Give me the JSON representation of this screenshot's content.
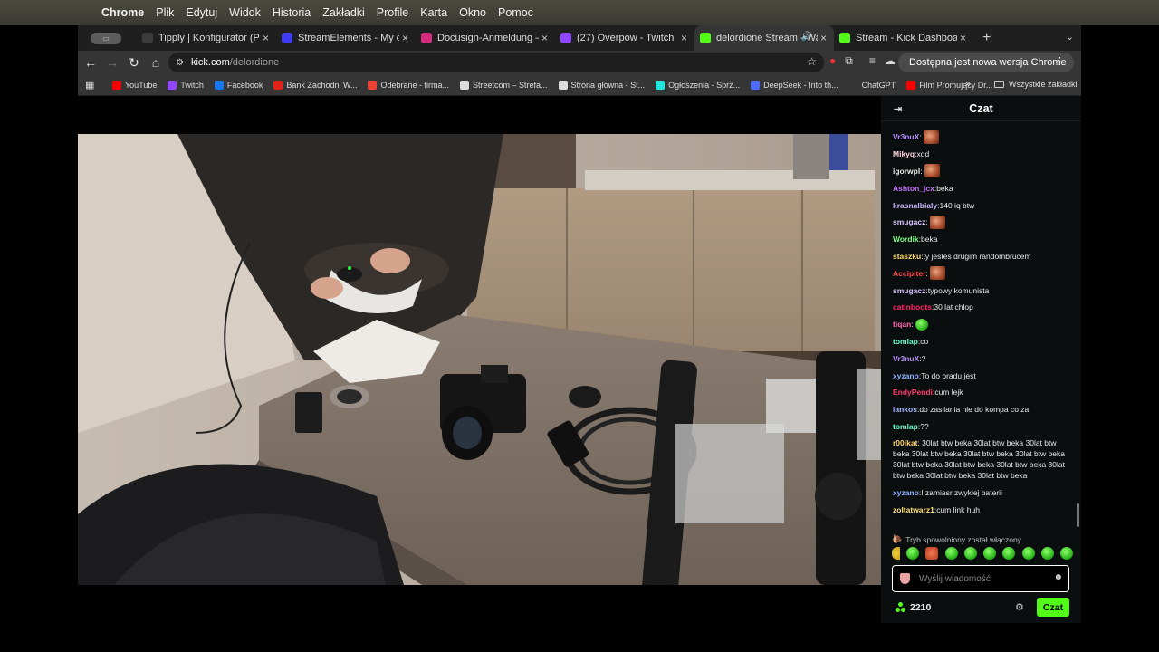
{
  "menubar": {
    "apple": "",
    "items": [
      "Chrome",
      "Plik",
      "Edytuj",
      "Widok",
      "Historia",
      "Zakładki",
      "Profile",
      "Karta",
      "Okno",
      "Pomoc"
    ]
  },
  "tabs": [
    {
      "title": "Tipply | Konfigurator (Powiadomienia)",
      "favicon_color": "#3c3c3c",
      "favicon_letter": "tip",
      "active": false
    },
    {
      "title": "StreamElements - My dashboard",
      "favicon_color": "#3d3cf2",
      "favicon_letter": "S",
      "active": false
    },
    {
      "title": "Docusign-Anmeldung – Anmelden",
      "favicon_color": "#d62b7f",
      "favicon_letter": "",
      "active": false
    },
    {
      "title": "(27) Overpow - Twitch",
      "favicon_color": "#9146ff",
      "favicon_letter": "",
      "active": false
    },
    {
      "title": "delordione Stream - Watch Live",
      "favicon_color": "#53fc18",
      "favicon_letter": "K",
      "active": true,
      "audio": true
    },
    {
      "title": "Stream - Kick Dashboard",
      "favicon_color": "#53fc18",
      "favicon_letter": "K",
      "active": false
    }
  ],
  "toolbar": {
    "url_host": "kick.com",
    "url_path": "/delordione",
    "update_label": "Dostępna jest nowa wersja Chrome"
  },
  "bookmarks": [
    {
      "label": "YouTube",
      "color": "#ff0000"
    },
    {
      "label": "Twitch",
      "color": "#9146ff"
    },
    {
      "label": "Facebook",
      "color": "#1877f2"
    },
    {
      "label": "Bank Zachodni W...",
      "color": "#e2231a"
    },
    {
      "label": "Odebrane - firma...",
      "color": "#ea4335"
    },
    {
      "label": "Streetcom – Strefa...",
      "color": "#dddddd"
    },
    {
      "label": "Strona główna - St...",
      "color": "#dddddd"
    },
    {
      "label": "Ogłoszenia - Sprz...",
      "color": "#23e5db"
    },
    {
      "label": "DeepSeek - Into th...",
      "color": "#4d6bfe"
    },
    {
      "label": "ChatGPT",
      "color": "#353535"
    },
    {
      "label": "Film Promujący Dr...",
      "color": "#ff0000"
    }
  ],
  "bookmarks_all": "Wszystkie zakładki",
  "chat": {
    "title": "Czat",
    "messages": [
      {
        "user": "Vr3nuX",
        "color": "#b58cff",
        "text": "",
        "emote": "face"
      },
      {
        "user": "Mikyq",
        "color": "#ffd1dc",
        "text": "xdd",
        "emote": ""
      },
      {
        "user": "igorwpl",
        "color": "#e6e6e6",
        "text": "",
        "emote": "face"
      },
      {
        "user": "Ashton_jcx",
        "color": "#c270ff",
        "text": "beka",
        "emote": ""
      },
      {
        "user": "krasnalbialy",
        "color": "#c9b6ff",
        "text": "140 iq btw",
        "emote": ""
      },
      {
        "user": "smugacz",
        "color": "#d7c7ff",
        "text": "",
        "emote": "face"
      },
      {
        "user": "Wordik",
        "color": "#7dff7d",
        "text": "beka",
        "emote": ""
      },
      {
        "user": "staszku",
        "color": "#ffdb6e",
        "text": "ty jestes drugim randombrucem",
        "emote": ""
      },
      {
        "user": "Accipiter",
        "color": "#ff4a4a",
        "text": "",
        "emote": "face"
      },
      {
        "user": "smugacz",
        "color": "#d7c7ff",
        "text": "typowy komunista",
        "emote": ""
      },
      {
        "user": "catinboots",
        "color": "#ff2a6a",
        "text": "30 lat chlop",
        "emote": ""
      },
      {
        "user": "tiqan",
        "color": "#ff6ab4",
        "text": "",
        "emote": "green"
      },
      {
        "user": "tomlap",
        "color": "#6effd1",
        "text": "co",
        "emote": ""
      },
      {
        "user": "Vr3nuX",
        "color": "#b58cff",
        "text": "?",
        "emote": ""
      },
      {
        "user": "xyzano",
        "color": "#8fb3ff",
        "text": "To do pradu jest",
        "emote": ""
      },
      {
        "user": "EndyPendi",
        "color": "#ff3b6b",
        "text": "cum lejk",
        "emote": ""
      },
      {
        "user": "lankos",
        "color": "#a6b8ff",
        "text": "do zasilania nie do kompa co za",
        "emote": ""
      },
      {
        "user": "tomlap",
        "color": "#6effd1",
        "text": "??",
        "emote": ""
      },
      {
        "user": "r00ikat",
        "color": "#ffd36e",
        "text": "30lat btw beka 30lat btw beka 30lat btw beka 30lat btw beka 30lat btw beka 30lat btw beka 30lat btw beka 30lat btw beka 30lat btw beka 30lat btw beka 30lat btw beka 30lat btw beka",
        "emote": "",
        "multi": true
      },
      {
        "user": "xyzano",
        "color": "#8fb3ff",
        "text": "I zamiasr zwykłej baterii",
        "emote": ""
      },
      {
        "user": "zoltatwarz1",
        "color": "#ffe07a",
        "text": "cum link huh",
        "emote": ""
      }
    ],
    "slowmode": "Tryb spowolniony został włączony",
    "input_placeholder": "Wyślij wiadomość",
    "points": "2210",
    "send_label": "Czat"
  },
  "colors": {
    "accent": "#53fc18",
    "chat_bg": "#0b0e0f",
    "toolbar_bg": "#353535"
  }
}
